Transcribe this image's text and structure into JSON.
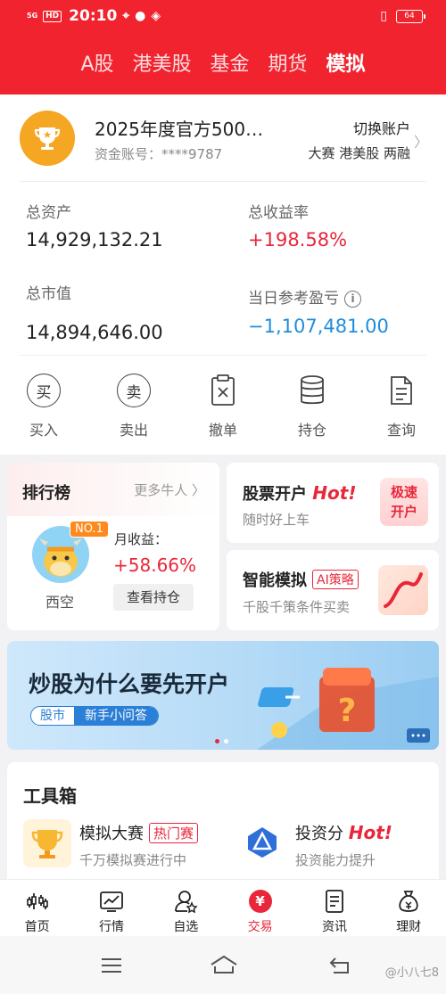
{
  "status_bar": {
    "signal": "5G",
    "hd": "HD",
    "time": "20:10",
    "battery": "64"
  },
  "tabs": [
    {
      "label": "A股",
      "active": false
    },
    {
      "label": "港美股",
      "active": false
    },
    {
      "label": "基金",
      "active": false
    },
    {
      "label": "期货",
      "active": false
    },
    {
      "label": "模拟",
      "active": true
    }
  ],
  "account": {
    "name": "2025年度官方500…",
    "id_label": "资金账号：",
    "id_value": "****9787",
    "switch_label": "切换账户",
    "tags": "大赛 港美股 两融"
  },
  "stats": {
    "total_assets_label": "总资产",
    "total_assets": "14,929,132.21",
    "total_return_label": "总收益率",
    "total_return": "+198.58%",
    "market_value_label": "总市值",
    "market_value": "14,894,646.00",
    "daily_pl_label": "当日参考盈亏",
    "daily_pl": "−1,107,481.00",
    "info_icon": "i"
  },
  "actions": [
    {
      "label": "买入",
      "icon_char": "买"
    },
    {
      "label": "卖出",
      "icon_char": "卖"
    },
    {
      "label": "撤单"
    },
    {
      "label": "持仓"
    },
    {
      "label": "查询"
    }
  ],
  "ranking": {
    "title": "排行榜",
    "more": "更多牛人",
    "badge": "NO.1",
    "user": "西空",
    "monthly_label": "月收益：",
    "monthly_value": "+58.66%",
    "button": "查看持仓"
  },
  "promo_account": {
    "title": "股票开户",
    "hot": "Hot!",
    "subtitle": "随时好上车",
    "box_line1": "极速",
    "box_line2": "开户"
  },
  "promo_ai": {
    "title": "智能模拟",
    "tag": "AI策略",
    "subtitle": "千股千策条件买卖"
  },
  "banner": {
    "title": "炒股为什么要先开户",
    "tag1": "股市",
    "tag2": "新手小问答"
  },
  "toolbox": {
    "title": "工具箱",
    "item1_title": "模拟大赛",
    "item1_tag": "热门赛",
    "item1_sub": "千万模拟赛进行中",
    "item2_title": "投资分",
    "item2_hot": "Hot!",
    "item2_sub": "投资能力提升"
  },
  "bottom_nav": [
    {
      "label": "首页",
      "icon": "home-candlestick-icon"
    },
    {
      "label": "行情",
      "icon": "chart-icon"
    },
    {
      "label": "自选",
      "icon": "user-star-icon"
    },
    {
      "label": "交易",
      "icon": "yen-circle-icon",
      "active": true,
      "char": "¥"
    },
    {
      "label": "资讯",
      "icon": "news-icon"
    },
    {
      "label": "理财",
      "icon": "money-bag-icon"
    }
  ],
  "watermark": "@小八七8",
  "colors": {
    "brand_red": "#f0232f",
    "gain_red": "#e8273a",
    "loss_blue": "#1f8ddb",
    "trophy_orange": "#f5a623"
  }
}
